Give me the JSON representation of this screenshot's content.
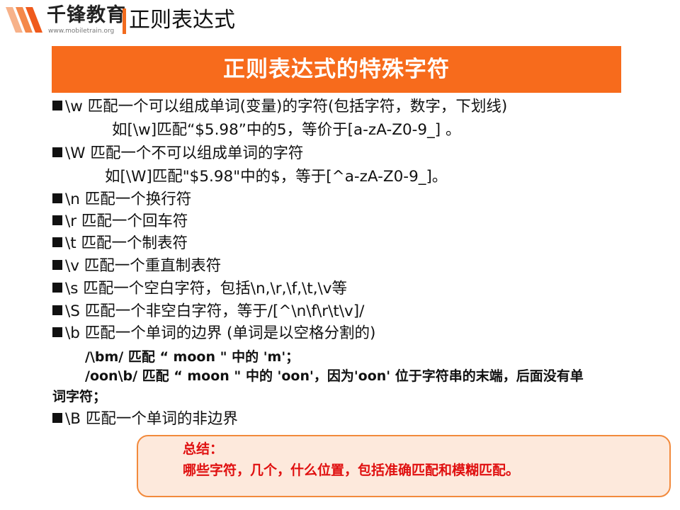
{
  "header": {
    "logo_name": "千锋教育",
    "logo_url": "www.mobiletrain.org",
    "title": "正则表达式"
  },
  "banner": {
    "title": "正则表达式的特殊字符"
  },
  "lines": [
    "\\w 匹配一个可以组成单词(变量)的字符(包括字符，数字，下划线)",
    "如[\\w]匹配“$5.98”中的5，等价于[a-zA-Z0-9_] 。",
    "\\W 匹配一个不可以组成单词的字符",
    "如[\\W]匹配\"$5.98\"中的$，等于[^a-zA-Z0-9_]。",
    "\\n 匹配一个换行符",
    "\\r 匹配一个回车符",
    "\\t 匹配一个制表符",
    "\\v 匹配一个重直制表符",
    "\\s 匹配一个空白字符，包括\\n,\\r,\\f,\\t,\\v等",
    "\\S 匹配一个非空白字符，等于/[^\\n\\f\\r\\t\\v]/",
    "\\b 匹配一个单词的边界 (单词是以空格分割的)",
    "/\\bm/ 匹配 “  moon  \" 中的 'm'；",
    "/oon\\b/ 匹配 “ moon \" 中的 'oon'，因为'oon' 位于字符串的末端，后面没有单",
    "词字符；",
    "\\B 匹配一个单词的非边界"
  ],
  "summary": {
    "heading": "总结：",
    "body": "哪些字符，几个，什么位置，包括准确匹配和模糊匹配。"
  },
  "colors": {
    "accent": "#f76b1c",
    "summary_text": "#e01010",
    "summary_bg": "#fde9dc",
    "summary_border": "#f28a3c"
  }
}
